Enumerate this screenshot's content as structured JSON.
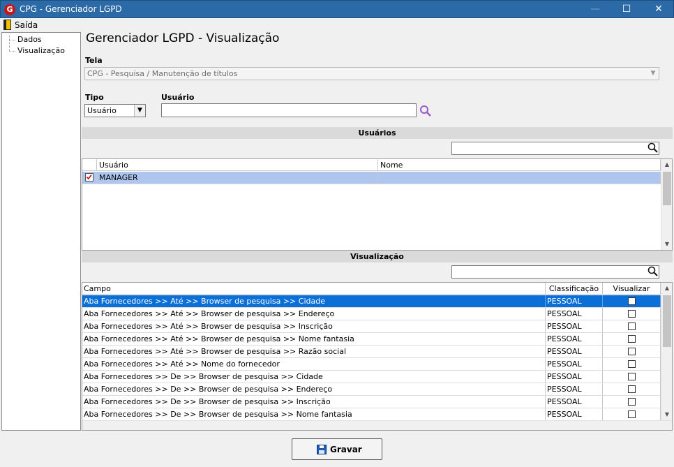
{
  "window": {
    "title": "CPG - Gerenciador LGPD",
    "icon_letter": "G"
  },
  "menu": {
    "exit_label": "Saída"
  },
  "tree": {
    "items": [
      "Dados",
      "Visualização"
    ]
  },
  "main": {
    "title": "Gerenciador LGPD - Visualização",
    "tela_label": "Tela",
    "tela_value": "CPG - Pesquisa / Manutenção de títulos",
    "tipo_label": "Tipo",
    "tipo_value": "Usuário",
    "usuario_label": "Usuário",
    "usuario_value": ""
  },
  "users_section": {
    "header": "Usuários",
    "filter_value": "",
    "columns": [
      "Usuário",
      "Nome"
    ],
    "rows": [
      {
        "checked": true,
        "usuario": "MANAGER",
        "nome": ""
      }
    ]
  },
  "view_section": {
    "header": "Visualização",
    "filter_value": "",
    "columns": [
      "Campo",
      "Classificação",
      "Visualizar"
    ],
    "rows": [
      {
        "campo": "Aba Fornecedores >> Até >> Browser de pesquisa >> Cidade",
        "classificacao": "PESSOAL",
        "visualizar": false
      },
      {
        "campo": "Aba Fornecedores >> Até >> Browser de pesquisa >> Endereço",
        "classificacao": "PESSOAL",
        "visualizar": false
      },
      {
        "campo": "Aba Fornecedores >> Até >> Browser de pesquisa >> Inscrição",
        "classificacao": "PESSOAL",
        "visualizar": false
      },
      {
        "campo": "Aba Fornecedores >> Até >> Browser de pesquisa >> Nome fantasia",
        "classificacao": "PESSOAL",
        "visualizar": false
      },
      {
        "campo": "Aba Fornecedores >> Até >> Browser de pesquisa >> Razão social",
        "classificacao": "PESSOAL",
        "visualizar": false
      },
      {
        "campo": "Aba Fornecedores >> Até >> Nome do fornecedor",
        "classificacao": "PESSOAL",
        "visualizar": false
      },
      {
        "campo": "Aba Fornecedores >> De >> Browser de pesquisa >> Cidade",
        "classificacao": "PESSOAL",
        "visualizar": false
      },
      {
        "campo": "Aba Fornecedores >> De >> Browser de pesquisa >> Endereço",
        "classificacao": "PESSOAL",
        "visualizar": false
      },
      {
        "campo": "Aba Fornecedores >> De >> Browser de pesquisa >> Inscrição",
        "classificacao": "PESSOAL",
        "visualizar": false
      },
      {
        "campo": "Aba Fornecedores >> De >> Browser de pesquisa >> Nome fantasia",
        "classificacao": "PESSOAL",
        "visualizar": false
      }
    ]
  },
  "footer": {
    "save_label": "Gravar"
  },
  "colors": {
    "titlebar": "#2b6aa6",
    "selection": "#0a6fd6",
    "section_header": "#dadada"
  }
}
